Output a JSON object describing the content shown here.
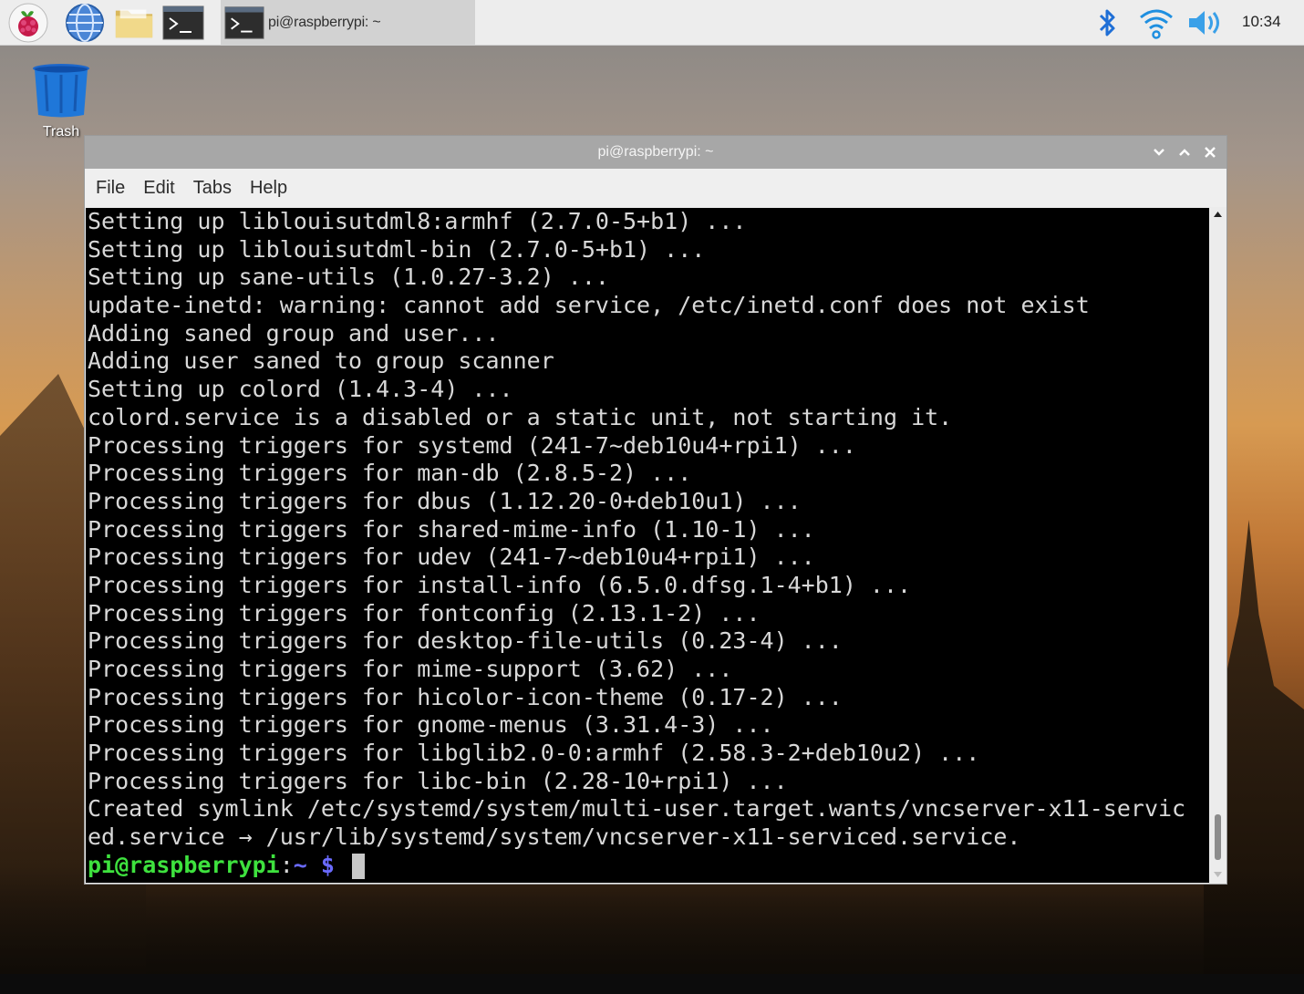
{
  "taskbar": {
    "launchers": [
      {
        "name": "raspberry-menu",
        "icon": "raspberry-icon"
      },
      {
        "name": "web-browser",
        "icon": "globe-icon"
      },
      {
        "name": "file-manager",
        "icon": "folder-icon"
      },
      {
        "name": "terminal",
        "icon": "terminal-icon"
      }
    ],
    "task_button_label": "pi@raspberrypi: ~",
    "clock": "10:34",
    "tray": [
      "bluetooth-icon",
      "wifi-icon",
      "volume-icon"
    ]
  },
  "desktop": {
    "trash_label": "Trash"
  },
  "window": {
    "title": "pi@raspberrypi: ~",
    "menu": [
      "File",
      "Edit",
      "Tabs",
      "Help"
    ],
    "terminal_lines": [
      "Setting up liblouisutdml8:armhf (2.7.0-5+b1) ...",
      "Setting up liblouisutdml-bin (2.7.0-5+b1) ...",
      "Setting up sane-utils (1.0.27-3.2) ...",
      "update-inetd: warning: cannot add service, /etc/inetd.conf does not exist",
      "Adding saned group and user...",
      "Adding user saned to group scanner",
      "Setting up colord (1.4.3-4) ...",
      "colord.service is a disabled or a static unit, not starting it.",
      "Processing triggers for systemd (241-7~deb10u4+rpi1) ...",
      "Processing triggers for man-db (2.8.5-2) ...",
      "Processing triggers for dbus (1.12.20-0+deb10u1) ...",
      "Processing triggers for shared-mime-info (1.10-1) ...",
      "Processing triggers for udev (241-7~deb10u4+rpi1) ...",
      "Processing triggers for install-info (6.5.0.dfsg.1-4+b1) ...",
      "Processing triggers for fontconfig (2.13.1-2) ...",
      "Processing triggers for desktop-file-utils (0.23-4) ...",
      "Processing triggers for mime-support (3.62) ...",
      "Processing triggers for hicolor-icon-theme (0.17-2) ...",
      "Processing triggers for gnome-menus (3.31.4-3) ...",
      "Processing triggers for libglib2.0-0:armhf (2.58.3-2+deb10u2) ...",
      "Processing triggers for libc-bin (2.28-10+rpi1) ...",
      "Created symlink /etc/systemd/system/multi-user.target.wants/vncserver-x11-servic",
      "ed.service → /usr/lib/systemd/system/vncserver-x11-serviced.service."
    ],
    "prompt": {
      "user_host": "pi@raspberrypi",
      "separator": ":",
      "path": "~ $"
    }
  }
}
